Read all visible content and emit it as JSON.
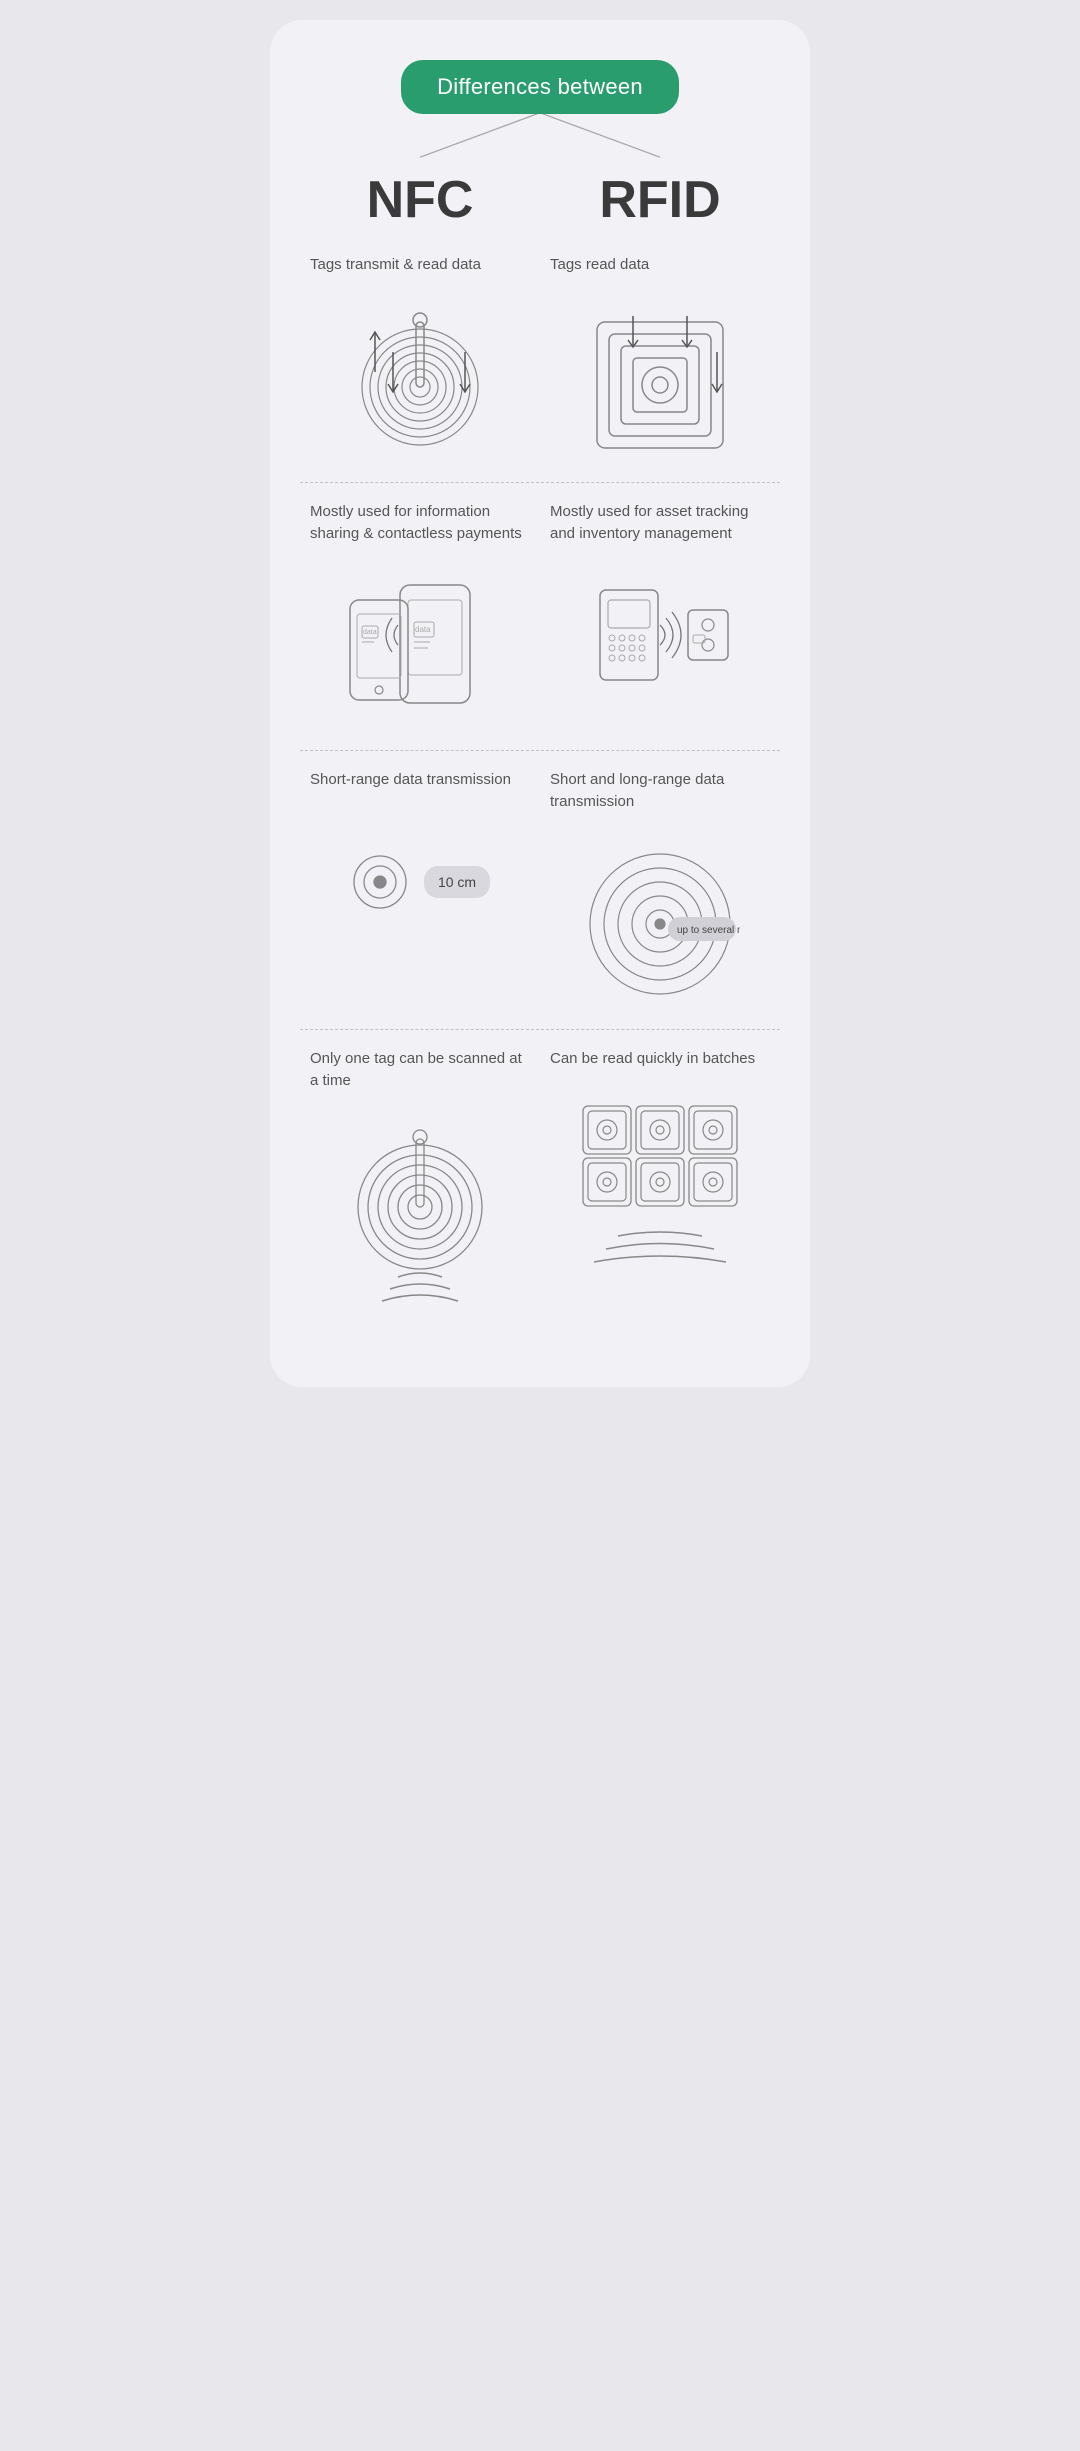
{
  "header": {
    "badge_text": "Differences between",
    "nfc_title": "NFC",
    "rfid_title": "RFID"
  },
  "sections": {
    "tags": {
      "nfc_label": "Tags transmit & read data",
      "rfid_label": "Tags read data"
    },
    "usage": {
      "nfc_label": "Mostly used for information sharing & contactless payments",
      "rfid_label": "Mostly used for asset tracking and inventory management"
    },
    "range": {
      "nfc_label": "Short-range data transmission",
      "rfid_label": "Short and long-range data transmission",
      "nfc_distance": "10 cm",
      "rfid_distance": "up to several meters"
    },
    "batch": {
      "nfc_label": "Only one tag can be scanned at a time",
      "rfid_label": "Can be read quickly in batches"
    }
  }
}
